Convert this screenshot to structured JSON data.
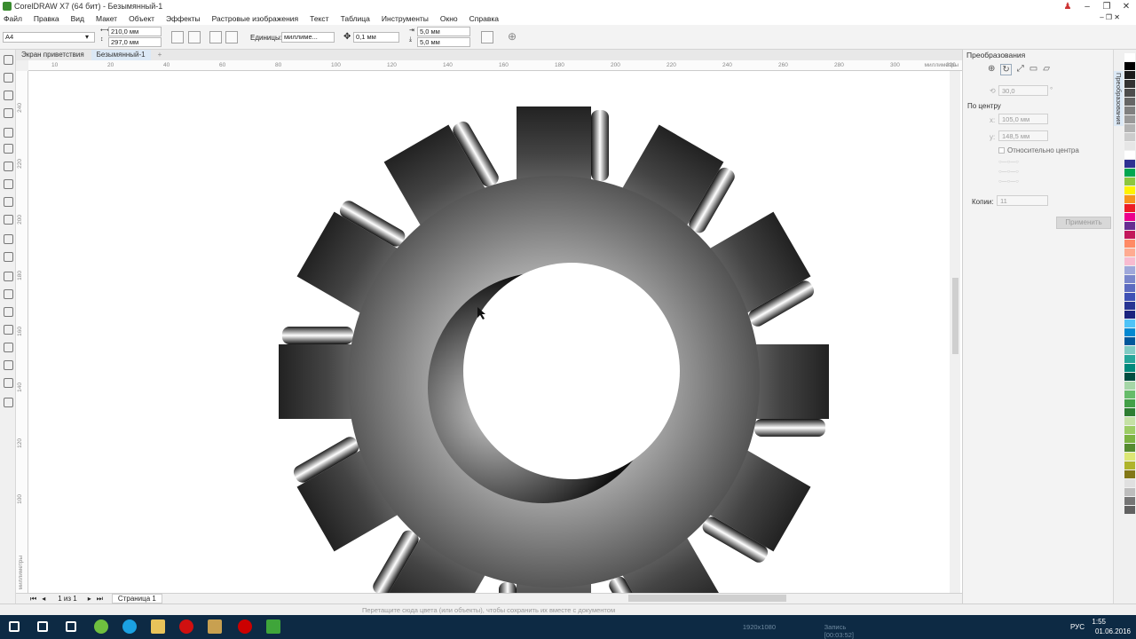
{
  "window": {
    "title": "CorelDRAW X7 (64 бит) - Безымянный-1",
    "minimize": "–",
    "restore": "❐",
    "close": "✕",
    "person": "♟"
  },
  "menu": [
    "Файл",
    "Правка",
    "Вид",
    "Макет",
    "Объект",
    "Эффекты",
    "Растровые изображения",
    "Текст",
    "Таблица",
    "Инструменты",
    "Окно",
    "Справка"
  ],
  "menu_sub_controls": "– ❐ ✕",
  "propbar": {
    "page_size": "A4",
    "width": "210,0 мм",
    "height": "297,0 мм",
    "units_label": "Единицы:",
    "units_value": "миллиме...",
    "nudge": "0,1 мм",
    "dup_x": "5,0 мм",
    "dup_y": "5,0 мм"
  },
  "tabs": [
    "Экран приветствия",
    "Безымянный-1",
    "+"
  ],
  "hruler": {
    "ticks": [
      "10",
      "20",
      "40",
      "60",
      "80",
      "100",
      "120",
      "140",
      "160",
      "180",
      "200",
      "220",
      "240",
      "260",
      "280",
      "300",
      "320"
    ],
    "unit": "миллиметры"
  },
  "vruler": {
    "ticks": [
      "240",
      "220",
      "200",
      "180",
      "160",
      "140",
      "120",
      "100"
    ],
    "unit": "миллиметры"
  },
  "pagebar": {
    "page_count": "1 из 1",
    "page_tab": "Страница 1"
  },
  "status": {
    "hint": "Перетащите сюда цвета (или объекты), чтобы сохранить их вместе с документом"
  },
  "docker": {
    "title": "Преобразования",
    "angle": "30,0",
    "angle_unit": "°",
    "center_label": "По центру",
    "x_label": "x:",
    "x_value": "105,0 мм",
    "y_label": "y:",
    "y_value": "148,5 мм",
    "relative_label": "Относительно центра",
    "copies_label": "Копии:",
    "copies_value": "11",
    "apply_label": "Применить",
    "vertical_tab": "Преобразования"
  },
  "palette": [
    "#ffffff",
    "#000000",
    "#1a1a1a",
    "#333333",
    "#4d4d4d",
    "#666666",
    "#808080",
    "#999999",
    "#b3b3b3",
    "#cccccc",
    "#e6e6e6",
    "#ffffff",
    "#2e3192",
    "#00a651",
    "#8dc63f",
    "#fff200",
    "#f7941d",
    "#ed1c24",
    "#ec008c",
    "#662d91",
    "#c2185b",
    "#ff8a65",
    "#ffab91",
    "#f8bbd0",
    "#9fa8da",
    "#7986cb",
    "#5c6bc0",
    "#3f51b5",
    "#283593",
    "#1a237e",
    "#4fc3f7",
    "#0288d1",
    "#01579b",
    "#80cbc4",
    "#26a69a",
    "#00897b",
    "#004d40",
    "#a5d6a7",
    "#66bb6a",
    "#43a047",
    "#2e7d32",
    "#c5e1a5",
    "#9ccc65",
    "#7cb342",
    "#558b2f",
    "#dce775",
    "#afb42b",
    "#827717",
    "#e0e0e0",
    "#bdbdbd",
    "#757575",
    "#616161"
  ],
  "taskbar": {
    "time": "1:55",
    "date": "01.06.2016",
    "lang": "РУС",
    "rec_res": "1920x1080",
    "rec_time": "Запись [00:03:52]",
    "icons": [
      "windows-start",
      "search",
      "task-view",
      "green-app",
      "skype",
      "folder",
      "opera",
      "media",
      "record",
      "coreldraw"
    ]
  }
}
